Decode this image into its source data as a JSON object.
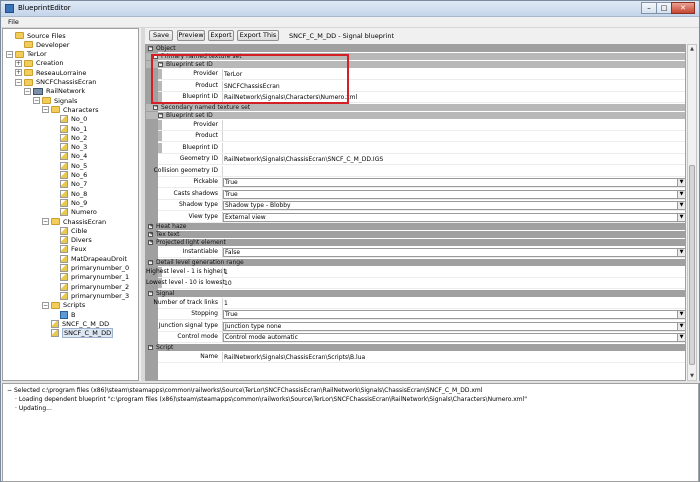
{
  "window": {
    "title": "BlueprintEditor",
    "min": "–",
    "max": "□",
    "close": "✕"
  },
  "menu": {
    "file": "File"
  },
  "tree": [
    {
      "label": "Source Files",
      "icon": "folder",
      "exp": "",
      "d": 0
    },
    {
      "label": "Developer",
      "icon": "folder",
      "exp": "",
      "d": 1
    },
    {
      "label": "TerLor",
      "icon": "folder",
      "exp": "−",
      "d": 0
    },
    {
      "label": "Creation",
      "icon": "folder",
      "exp": "+",
      "d": 1
    },
    {
      "label": "ReseauLorraine",
      "icon": "folder",
      "exp": "+",
      "d": 1
    },
    {
      "label": "SNCFChassisEcran",
      "icon": "folder",
      "exp": "−",
      "d": 1
    },
    {
      "label": "RailNetwork",
      "icon": "rail",
      "exp": "−",
      "d": 2
    },
    {
      "label": "Signals",
      "icon": "folder",
      "exp": "−",
      "d": 3
    },
    {
      "label": "Characters",
      "icon": "folder",
      "exp": "−",
      "d": 4
    },
    {
      "label": "No_0",
      "icon": "file",
      "exp": "",
      "d": 5
    },
    {
      "label": "No_1",
      "icon": "file",
      "exp": "",
      "d": 5
    },
    {
      "label": "No_2",
      "icon": "file",
      "exp": "",
      "d": 5
    },
    {
      "label": "No_3",
      "icon": "file",
      "exp": "",
      "d": 5
    },
    {
      "label": "No_4",
      "icon": "file",
      "exp": "",
      "d": 5
    },
    {
      "label": "No_5",
      "icon": "file",
      "exp": "",
      "d": 5
    },
    {
      "label": "No_6",
      "icon": "file",
      "exp": "",
      "d": 5
    },
    {
      "label": "No_7",
      "icon": "file",
      "exp": "",
      "d": 5
    },
    {
      "label": "No_8",
      "icon": "file",
      "exp": "",
      "d": 5
    },
    {
      "label": "No_9",
      "icon": "file",
      "exp": "",
      "d": 5
    },
    {
      "label": "Numero",
      "icon": "file",
      "exp": "",
      "d": 5
    },
    {
      "label": "ChassisEcran",
      "icon": "folder",
      "exp": "−",
      "d": 4
    },
    {
      "label": "Cible",
      "icon": "file",
      "exp": "",
      "d": 5
    },
    {
      "label": "Divers",
      "icon": "file",
      "exp": "",
      "d": 5
    },
    {
      "label": "Feux",
      "icon": "file",
      "exp": "",
      "d": 5
    },
    {
      "label": "MatDrapeauDroit",
      "icon": "file",
      "exp": "",
      "d": 5
    },
    {
      "label": "primarynumber_0",
      "icon": "file",
      "exp": "",
      "d": 5
    },
    {
      "label": "primarynumber_1",
      "icon": "file",
      "exp": "",
      "d": 5
    },
    {
      "label": "primarynumber_2",
      "icon": "file",
      "exp": "",
      "d": 5
    },
    {
      "label": "primarynumber_3",
      "icon": "file",
      "exp": "",
      "d": 5
    },
    {
      "label": "Scripts",
      "icon": "folder",
      "exp": "−",
      "d": 4
    },
    {
      "label": "B",
      "icon": "script",
      "exp": "",
      "d": 5
    },
    {
      "label": "SNCF_C_M_DD",
      "icon": "file",
      "exp": "",
      "d": 4
    },
    {
      "label": "SNCF_C_M_DD",
      "icon": "file",
      "exp": "",
      "d": 4,
      "selected": true
    }
  ],
  "toolbar": {
    "save": "Save",
    "preview": "Preview",
    "export": "Export",
    "export_this": "Export This",
    "info": "SNCF_C_M_DD - Signal blueprint"
  },
  "grid": [
    {
      "k": "sec",
      "text": "Object",
      "d": 0
    },
    {
      "k": "sec",
      "text": "Primary named texture set",
      "d": 1
    },
    {
      "k": "sec",
      "text": "Blueprint set ID",
      "d": 2
    },
    {
      "k": "val",
      "label": "Provider",
      "value": "TerLor",
      "d": 2
    },
    {
      "k": "val",
      "label": "Product",
      "value": "SNCFChassisEcran",
      "d": 2
    },
    {
      "k": "val",
      "label": "Blueprint ID",
      "value": "RailNetwork\\Signals\\Characters\\Numero.xml",
      "d": 1
    },
    {
      "k": "sec",
      "text": "Secondary named texture set",
      "d": 1
    },
    {
      "k": "sec",
      "text": "Blueprint set ID",
      "d": 2
    },
    {
      "k": "val",
      "label": "Provider",
      "value": "",
      "d": 2
    },
    {
      "k": "val",
      "label": "Product",
      "value": "",
      "d": 2
    },
    {
      "k": "val",
      "label": "Blueprint ID",
      "value": "",
      "d": 1
    },
    {
      "k": "val",
      "label": "Geometry ID",
      "value": "RailNetwork\\Signals\\ChassisEcran\\SNCF_C_M_DD.IGS",
      "d": 0
    },
    {
      "k": "val",
      "label": "Collision geometry ID",
      "value": "",
      "d": 0
    },
    {
      "k": "combo",
      "label": "Pickable",
      "value": "True",
      "d": 0
    },
    {
      "k": "combo",
      "label": "Casts shadows",
      "value": "True",
      "d": 0
    },
    {
      "k": "combo",
      "label": "Shadow type",
      "value": "Shadow type - Blobby",
      "d": 0
    },
    {
      "k": "combo",
      "label": "View type",
      "value": "External view",
      "d": 0
    },
    {
      "k": "sec",
      "text": "Heat haze",
      "d": 0,
      "collapsed": true
    },
    {
      "k": "sec",
      "text": "Tex text",
      "d": 0,
      "collapsed": true
    },
    {
      "k": "sec",
      "text": "Projected light element",
      "d": 0,
      "collapsed": true
    },
    {
      "k": "combo",
      "label": "Instantiable",
      "value": "False",
      "d": 0
    },
    {
      "k": "sec",
      "text": "Detail level generation range",
      "d": 0
    },
    {
      "k": "val",
      "label": "Highest level - 1 is highest",
      "value": "1",
      "d": 1
    },
    {
      "k": "val",
      "label": "Lowest level - 10 is lowest",
      "value": "10",
      "d": 1
    },
    {
      "k": "sec",
      "text": "Signal",
      "d": -1
    },
    {
      "k": "val",
      "label": "Number of track links",
      "value": "1",
      "d": 0
    },
    {
      "k": "combo",
      "label": "Stopping",
      "value": "True",
      "d": 0
    },
    {
      "k": "combo",
      "label": "Junction signal type",
      "value": "Junction type none",
      "d": 0
    },
    {
      "k": "combo",
      "label": "Control mode",
      "value": "Control mode automatic",
      "d": 0
    },
    {
      "k": "sec",
      "text": "Script",
      "d": -1
    },
    {
      "k": "val",
      "label": "Name",
      "value": "RailNetwork\\Signals\\ChassisEcran\\Scripts\\B.lua",
      "d": 0
    }
  ],
  "log": [
    {
      "text": "Selected c:\\program files (x86)\\steam\\steamapps\\common\\railworks\\Source\\TerLor\\SNCFChassisEcran\\RailNetwork\\Signals\\ChassisEcran\\SNCF_C_M_DD.xml",
      "d": 0,
      "exp": "−"
    },
    {
      "text": "Loading dependent blueprint \"c:\\program files (x86)\\steam\\steamapps\\common\\railworks\\Source\\TerLor\\SNCFChassisEcran\\RailNetwork\\Signals\\Characters\\Numero.xml\"",
      "d": 1,
      "exp": ""
    },
    {
      "text": "Updating...",
      "d": 1,
      "exp": ""
    }
  ],
  "colors": {
    "highlight_box": "#d51f26",
    "section_header": "#a0a0a0",
    "subsection_header": "#b8b8b8"
  }
}
